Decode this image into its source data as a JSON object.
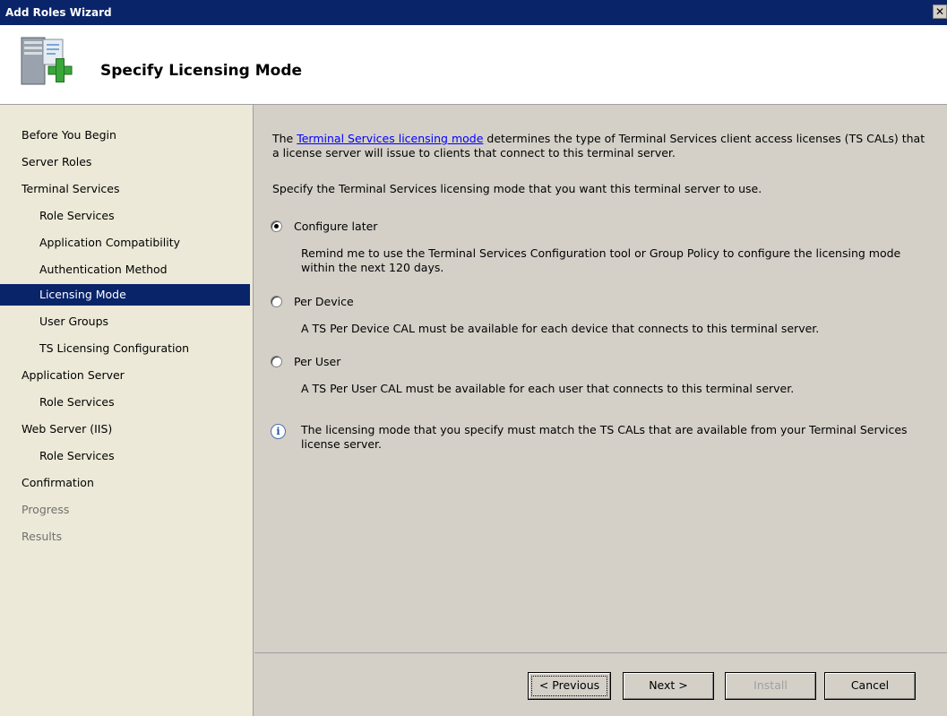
{
  "window": {
    "title": "Add Roles Wizard",
    "close_glyph": "✕"
  },
  "header": {
    "title": "Specify Licensing Mode",
    "icon": "server-add-icon"
  },
  "sidebar": {
    "items": [
      {
        "label": "Before You Begin",
        "level": 0,
        "state": "normal"
      },
      {
        "label": "Server Roles",
        "level": 0,
        "state": "normal"
      },
      {
        "label": "Terminal Services",
        "level": 0,
        "state": "normal"
      },
      {
        "label": "Role Services",
        "level": 1,
        "state": "normal"
      },
      {
        "label": "Application Compatibility",
        "level": 1,
        "state": "normal"
      },
      {
        "label": "Authentication Method",
        "level": 1,
        "state": "normal"
      },
      {
        "label": "Licensing Mode",
        "level": 1,
        "state": "selected"
      },
      {
        "label": "User Groups",
        "level": 1,
        "state": "normal"
      },
      {
        "label": "TS Licensing Configuration",
        "level": 1,
        "state": "normal"
      },
      {
        "label": "Application Server",
        "level": 0,
        "state": "normal"
      },
      {
        "label": "Role Services",
        "level": 1,
        "state": "normal"
      },
      {
        "label": "Web Server (IIS)",
        "level": 0,
        "state": "normal"
      },
      {
        "label": "Role Services",
        "level": 1,
        "state": "normal"
      },
      {
        "label": "Confirmation",
        "level": 0,
        "state": "normal"
      },
      {
        "label": "Progress",
        "level": 0,
        "state": "disabled"
      },
      {
        "label": "Results",
        "level": 0,
        "state": "disabled"
      }
    ]
  },
  "main": {
    "desc_prefix": "The ",
    "desc_link": "Terminal Services licensing mode",
    "desc_suffix": " determines the type of Terminal Services client access licenses (TS CALs) that a license server will issue to clients that connect to this terminal server.",
    "instruction": "Specify the Terminal Services licensing mode that you want this terminal server to use.",
    "options": [
      {
        "label": "Configure later",
        "checked": true,
        "description": "Remind me to use the Terminal Services Configuration tool or Group Policy to configure the licensing mode within the next 120 days."
      },
      {
        "label": "Per Device",
        "checked": false,
        "description": "A TS Per Device CAL must be available for each device that connects to this terminal server."
      },
      {
        "label": "Per User",
        "checked": false,
        "description": "A TS Per User CAL must be available for each user that connects to this terminal server."
      }
    ],
    "info_icon": "i",
    "info_text": "The licensing mode that you specify must match the TS CALs that are available from your Terminal Services license server."
  },
  "footer": {
    "previous_label": "< Previous",
    "next_label": "Next >",
    "install_label": "Install",
    "cancel_label": "Cancel"
  },
  "colors": {
    "selection": "#0a246a",
    "titlebar": "#0a246a",
    "link": "#0000ff",
    "disabled": "#707070"
  }
}
